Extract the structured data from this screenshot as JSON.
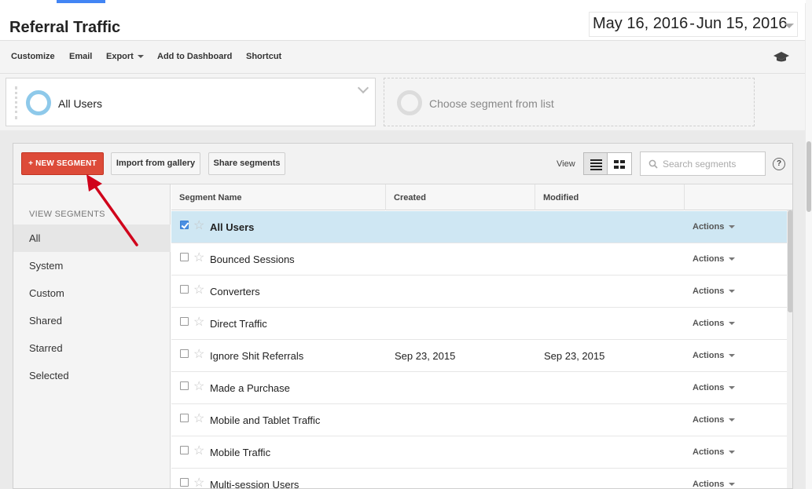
{
  "header": {
    "title": "Referral Traffic",
    "date_start": "May 16, 2016",
    "date_sep": "-",
    "date_end": "Jun 15, 2016"
  },
  "toolbar": {
    "customize": "Customize",
    "email": "Email",
    "export": "Export",
    "add_to_dashboard": "Add to Dashboard",
    "shortcut": "Shortcut"
  },
  "segments_bar": {
    "active_segment": "All Users",
    "empty_slot": "Choose segment from list"
  },
  "panel": {
    "new_segment": "+ NEW SEGMENT",
    "import_gallery": "Import from gallery",
    "share_segments": "Share segments",
    "view_label": "View",
    "search_placeholder": "Search segments",
    "help": "?"
  },
  "sidebar": {
    "heading": "VIEW SEGMENTS",
    "items": [
      "All",
      "System",
      "Custom",
      "Shared",
      "Starred",
      "Selected"
    ],
    "active_index": 0
  },
  "table": {
    "columns": [
      "Segment Name",
      "Created",
      "Modified"
    ],
    "action_label": "Actions",
    "rows": [
      {
        "name": "All Users",
        "created": "",
        "modified": "",
        "checked": true
      },
      {
        "name": "Bounced Sessions",
        "created": "",
        "modified": "",
        "checked": false
      },
      {
        "name": "Converters",
        "created": "",
        "modified": "",
        "checked": false
      },
      {
        "name": "Direct Traffic",
        "created": "",
        "modified": "",
        "checked": false
      },
      {
        "name": "Ignore Shit Referrals",
        "created": "Sep 23, 2015",
        "modified": "Sep 23, 2015",
        "checked": false
      },
      {
        "name": "Made a Purchase",
        "created": "",
        "modified": "",
        "checked": false
      },
      {
        "name": "Mobile and Tablet Traffic",
        "created": "",
        "modified": "",
        "checked": false
      },
      {
        "name": "Mobile Traffic",
        "created": "",
        "modified": "",
        "checked": false
      },
      {
        "name": "Multi-session Users",
        "created": "",
        "modified": "",
        "checked": false
      }
    ]
  },
  "colors": {
    "new_segment_button": "#dd4b39",
    "selected_row": "#cfe7f3",
    "segment_ring": "#8ec9ea",
    "annotation_arrow": "#d0021b",
    "top_accent": "#4285f4"
  }
}
